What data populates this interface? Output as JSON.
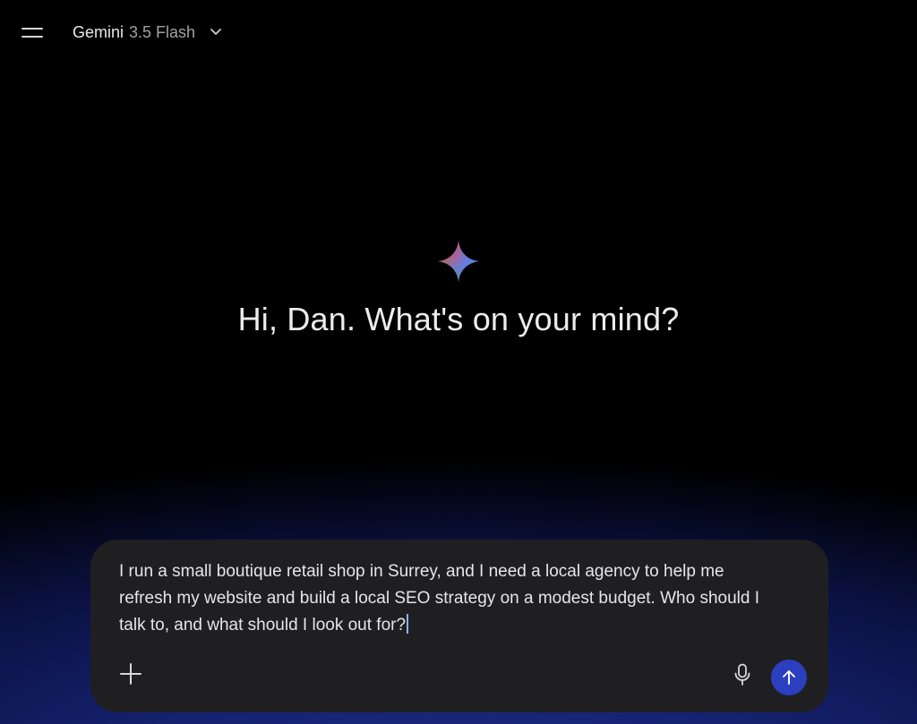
{
  "header": {
    "menu_icon": "hamburger-menu-icon",
    "model_name": "Gemini",
    "model_version": "3.5 Flash",
    "dropdown_icon": "chevron-down-icon"
  },
  "main": {
    "logo_icon": "gemini-sparkle-icon",
    "greeting": "Hi, Dan. What's on your mind?"
  },
  "composer": {
    "prompt_text": "I run a small boutique retail shop in Surrey, and I need a local agency to help me refresh my website and build a local SEO strategy on a modest budget. Who should I talk to, and what should I look out for?",
    "add_icon": "plus-icon",
    "mic_icon": "microphone-icon",
    "send_icon": "arrow-up-icon"
  },
  "colors": {
    "background": "#000000",
    "gradient_accent": "#1f2e8a",
    "composer_bg": "#1f1f21",
    "send_button": "#2b3fbf"
  }
}
